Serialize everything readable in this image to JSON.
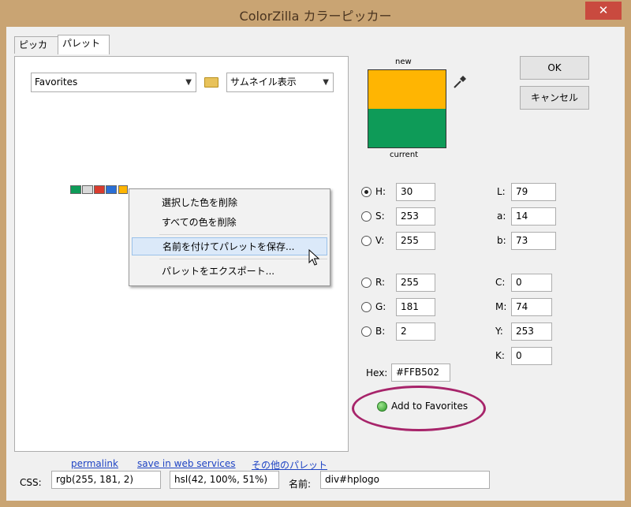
{
  "window": {
    "title": "ColorZilla カラーピッカー",
    "close_label": "✕"
  },
  "tabs": [
    {
      "label": "ピッカー"
    },
    {
      "label": "パレット"
    }
  ],
  "palette": {
    "palette_select": "Favorites",
    "view_select": "サムネイル表示",
    "swatches": [
      "#0e9b58",
      "#d9d9d9",
      "#d93b2e",
      "#2a6fd6",
      "#ffb502"
    ]
  },
  "context_menu": {
    "items": [
      {
        "label": "選択した色を削除"
      },
      {
        "label": "すべての色を削除"
      },
      {
        "label": "名前を付けてパレットを保存..."
      },
      {
        "label": "パレットをエクスポート..."
      }
    ]
  },
  "links": {
    "permalink": "permalink",
    "save": "save in web services",
    "other": "その他のパレット"
  },
  "preview": {
    "new_label": "new",
    "current_label": "current",
    "new_color": "#ffb502",
    "current_color": "#0e9b58"
  },
  "buttons": {
    "ok": "OK",
    "cancel": "キャンセル",
    "add_favorites": "Add to Favorites"
  },
  "hsv": [
    {
      "label": "H:",
      "value": "30",
      "checked": true
    },
    {
      "label": "S:",
      "value": "253",
      "checked": false
    },
    {
      "label": "V:",
      "value": "255",
      "checked": false
    }
  ],
  "rgb": [
    {
      "label": "R:",
      "value": "255"
    },
    {
      "label": "G:",
      "value": "181"
    },
    {
      "label": "B:",
      "value": "2"
    }
  ],
  "lab": [
    {
      "label": "L:",
      "value": "79"
    },
    {
      "label": "a:",
      "value": "14"
    },
    {
      "label": "b:",
      "value": "73"
    }
  ],
  "cmyk": [
    {
      "label": "C:",
      "value": "0"
    },
    {
      "label": "M:",
      "value": "74"
    },
    {
      "label": "Y:",
      "value": "253"
    },
    {
      "label": "K:",
      "value": "0"
    }
  ],
  "hex": {
    "label": "Hex:",
    "value": "#FFB502"
  },
  "bottom": {
    "css_label": "CSS:",
    "css_rgb": "rgb(255, 181, 2)",
    "css_hsl": "hsl(42, 100%, 51%)",
    "name_label": "名前:",
    "name_value": "div#hplogo"
  }
}
